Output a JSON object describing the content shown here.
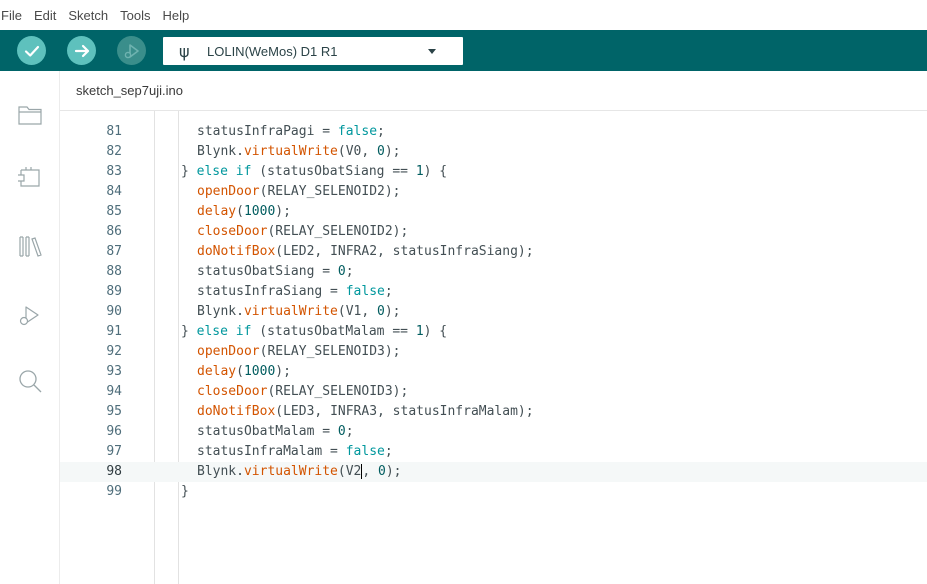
{
  "menu": [
    "File",
    "Edit",
    "Sketch",
    "Tools",
    "Help"
  ],
  "toolbar": {
    "verify_icon": "checkmark-icon",
    "upload_icon": "arrow-right-icon",
    "debug_icon": "debug-icon",
    "board_usb_glyph": "ψ",
    "board_name": "LOLIN(WeMos) D1 R1"
  },
  "sidebar": {
    "items": [
      "folder-icon",
      "board-manager-icon",
      "library-manager-icon",
      "debug-icon",
      "search-icon"
    ]
  },
  "tab": {
    "filename": "sketch_sep7uji.ino"
  },
  "colors": {
    "toolbar_bg": "#006468",
    "button_bg": "#5ec1bd",
    "keyword": "#00979d",
    "function": "#d35400",
    "number": "#005c5f",
    "line_number": "#4f6e7b"
  },
  "editor": {
    "active_line": 98,
    "lines": [
      {
        "n": "81",
        "indent": 4,
        "tokens": [
          [
            "p",
            "statusInfraPagi = "
          ],
          [
            "k",
            "false"
          ],
          [
            "p",
            ";"
          ]
        ]
      },
      {
        "n": "82",
        "indent": 4,
        "tokens": [
          [
            "p",
            "Blynk."
          ],
          [
            "f",
            "virtualWrite"
          ],
          [
            "p",
            "(V0, "
          ],
          [
            "u",
            "0"
          ],
          [
            "p",
            ");"
          ]
        ]
      },
      {
        "n": "83",
        "indent": 2,
        "tokens": [
          [
            "p",
            "} "
          ],
          [
            "k",
            "else"
          ],
          [
            "p",
            " "
          ],
          [
            "k",
            "if"
          ],
          [
            "p",
            " (statusObatSiang == "
          ],
          [
            "u",
            "1"
          ],
          [
            "p",
            ") {"
          ]
        ]
      },
      {
        "n": "84",
        "indent": 4,
        "tokens": [
          [
            "f",
            "openDoor"
          ],
          [
            "p",
            "(RELAY_SELENOID2);"
          ]
        ]
      },
      {
        "n": "85",
        "indent": 4,
        "tokens": [
          [
            "f",
            "delay"
          ],
          [
            "p",
            "("
          ],
          [
            "u",
            "1000"
          ],
          [
            "p",
            ");"
          ]
        ]
      },
      {
        "n": "86",
        "indent": 4,
        "tokens": [
          [
            "f",
            "closeDoor"
          ],
          [
            "p",
            "(RELAY_SELENOID2);"
          ]
        ]
      },
      {
        "n": "87",
        "indent": 4,
        "tokens": [
          [
            "f",
            "doNotifBox"
          ],
          [
            "p",
            "(LED2, INFRA2, statusInfraSiang);"
          ]
        ]
      },
      {
        "n": "88",
        "indent": 4,
        "tokens": [
          [
            "p",
            "statusObatSiang = "
          ],
          [
            "u",
            "0"
          ],
          [
            "p",
            ";"
          ]
        ]
      },
      {
        "n": "89",
        "indent": 4,
        "tokens": [
          [
            "p",
            "statusInfraSiang = "
          ],
          [
            "k",
            "false"
          ],
          [
            "p",
            ";"
          ]
        ]
      },
      {
        "n": "90",
        "indent": 4,
        "tokens": [
          [
            "p",
            "Blynk."
          ],
          [
            "f",
            "virtualWrite"
          ],
          [
            "p",
            "(V1, "
          ],
          [
            "u",
            "0"
          ],
          [
            "p",
            ");"
          ]
        ]
      },
      {
        "n": "91",
        "indent": 2,
        "tokens": [
          [
            "p",
            "} "
          ],
          [
            "k",
            "else"
          ],
          [
            "p",
            " "
          ],
          [
            "k",
            "if"
          ],
          [
            "p",
            " (statusObatMalam == "
          ],
          [
            "u",
            "1"
          ],
          [
            "p",
            ") {"
          ]
        ]
      },
      {
        "n": "92",
        "indent": 4,
        "tokens": [
          [
            "f",
            "openDoor"
          ],
          [
            "p",
            "(RELAY_SELENOID3);"
          ]
        ]
      },
      {
        "n": "93",
        "indent": 4,
        "tokens": [
          [
            "f",
            "delay"
          ],
          [
            "p",
            "("
          ],
          [
            "u",
            "1000"
          ],
          [
            "p",
            ");"
          ]
        ]
      },
      {
        "n": "94",
        "indent": 4,
        "tokens": [
          [
            "f",
            "closeDoor"
          ],
          [
            "p",
            "(RELAY_SELENOID3);"
          ]
        ]
      },
      {
        "n": "95",
        "indent": 4,
        "tokens": [
          [
            "f",
            "doNotifBox"
          ],
          [
            "p",
            "(LED3, INFRA3, statusInfraMalam);"
          ]
        ]
      },
      {
        "n": "96",
        "indent": 4,
        "tokens": [
          [
            "p",
            "statusObatMalam = "
          ],
          [
            "u",
            "0"
          ],
          [
            "p",
            ";"
          ]
        ]
      },
      {
        "n": "97",
        "indent": 4,
        "tokens": [
          [
            "p",
            "statusInfraMalam = "
          ],
          [
            "k",
            "false"
          ],
          [
            "p",
            ";"
          ]
        ]
      },
      {
        "n": "98",
        "indent": 4,
        "tokens": [
          [
            "p",
            "Blynk."
          ],
          [
            "f",
            "virtualWrite"
          ],
          [
            "p",
            "(V2"
          ],
          [
            "c",
            ""
          ],
          [
            "p",
            ", "
          ],
          [
            "u",
            "0"
          ],
          [
            "p",
            ");"
          ]
        ]
      },
      {
        "n": "99",
        "indent": 2,
        "tokens": [
          [
            "p",
            "}"
          ]
        ]
      }
    ]
  }
}
